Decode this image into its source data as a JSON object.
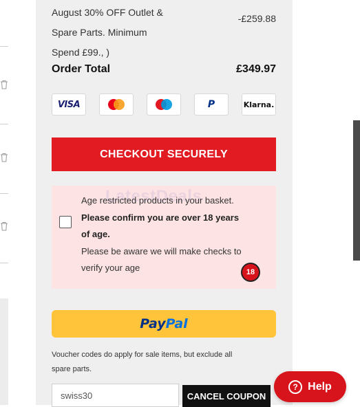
{
  "discount": {
    "lines": [
      "August 30% OFF Outlet &",
      "Spare Parts. Minimum",
      "Spend £99., )"
    ],
    "amount": "-£259.88"
  },
  "order_total": {
    "label": "Order Total",
    "value": "£349.97"
  },
  "payment_methods": [
    {
      "name": "VISA",
      "icon": "visa-logo"
    },
    {
      "name": "Mastercard",
      "icon": "mastercard-logo",
      "colors": [
        "#eb001b",
        "#f79e1b"
      ]
    },
    {
      "name": "Maestro",
      "icon": "maestro-logo",
      "colors": [
        "#e21b23",
        "#0099df"
      ]
    },
    {
      "name": "PayPal",
      "icon": "paypal-logo"
    },
    {
      "name": "Klarna.",
      "icon": "klarna-logo"
    }
  ],
  "checkout": {
    "label": "CHECKOUT SECURELY",
    "color": "#e21b23"
  },
  "age_check": {
    "line1": "Age restricted products in your basket.",
    "bold1": "Please confirm you are over 18 years",
    "bold2": "of age.",
    "line2": "Please be aware we will make checks to",
    "line3": "verify your age",
    "badge": "18",
    "watermark": "LatestDeals"
  },
  "paypal_button": {
    "pay": "Pay",
    "pal": "Pal",
    "color": "#ffc439"
  },
  "voucher": {
    "note_line1": "Voucher codes do apply for sale items, but exclude all",
    "note_line2": "spare parts.",
    "input_value": "swiss30",
    "cancel_label": "CANCEL COUPON"
  },
  "help": {
    "label": "Help",
    "icon": "question-icon"
  }
}
